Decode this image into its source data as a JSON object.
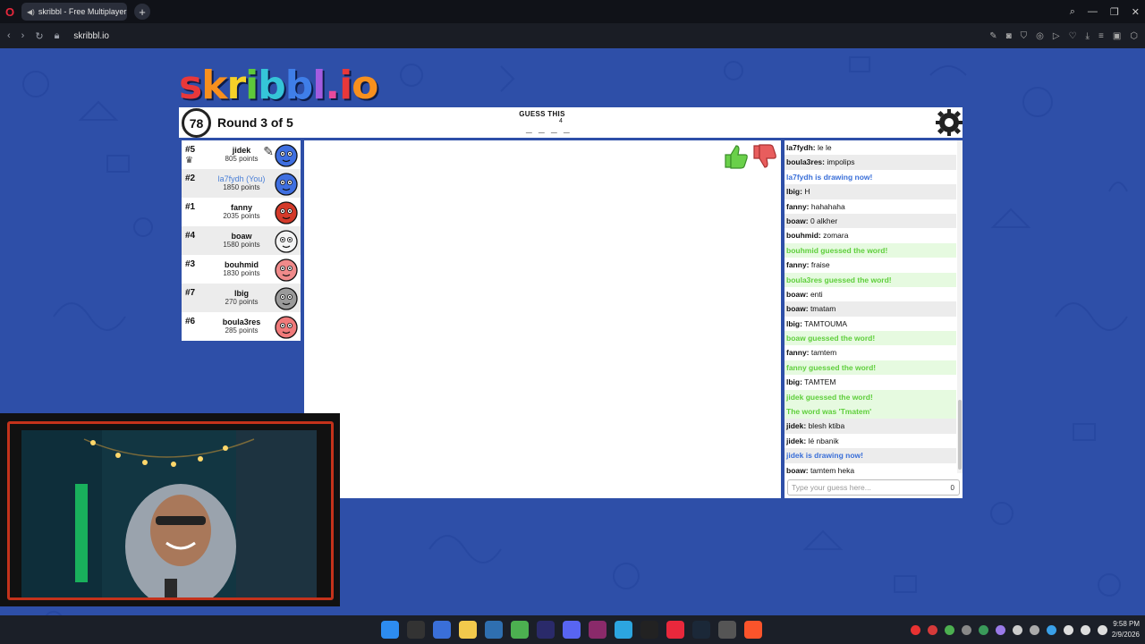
{
  "browser": {
    "tab_title": "skribbl - Free Multiplayer",
    "url": "skribbl.io",
    "new_tab_symbol": "+",
    "address_bar_icons": [
      "back-icon",
      "forward-icon",
      "reload-icon",
      "lock-icon"
    ],
    "window_controls": [
      "search-icon",
      "minimize-icon",
      "maximize-icon",
      "close-icon"
    ]
  },
  "game": {
    "logo_letters": [
      "s",
      "k",
      "r",
      "i",
      "b",
      "b",
      "l",
      ".",
      "i",
      "o"
    ],
    "logo_colors": [
      "#e8383a",
      "#f7901e",
      "#f6d128",
      "#5ec83a",
      "#35c5d8",
      "#3f7ee8",
      "#a35ce0",
      "#e84a9c",
      "#e8383a",
      "#f7901e"
    ],
    "timer": "78",
    "round_text": "Round 3 of 5",
    "guess_label": "GUESS THIS",
    "word_length": "4",
    "word_blanks": "_ _ _ _",
    "players": [
      {
        "rank": "#5",
        "name": "jidek",
        "points": "805 points",
        "you": false,
        "avatar_color": "#3f6fe0",
        "drawing": true
      },
      {
        "rank": "#2",
        "name": "la7fydh (You)",
        "points": "1850 points",
        "you": true,
        "avatar_color": "#3f6fe0",
        "drawing": false
      },
      {
        "rank": "#1",
        "name": "fanny",
        "points": "2035 points",
        "you": false,
        "avatar_color": "#d43a2a",
        "drawing": false
      },
      {
        "rank": "#4",
        "name": "boaw",
        "points": "1580 points",
        "you": false,
        "avatar_color": "#f4f4f4",
        "drawing": false
      },
      {
        "rank": "#3",
        "name": "bouhmid",
        "points": "1830 points",
        "you": false,
        "avatar_color": "#f08a8a",
        "drawing": false
      },
      {
        "rank": "#7",
        "name": "lbig",
        "points": "270 points",
        "you": false,
        "avatar_color": "#9a9a9a",
        "drawing": false
      },
      {
        "rank": "#6",
        "name": "boula3res",
        "points": "285 points",
        "you": false,
        "avatar_color": "#f07a7a",
        "drawing": false
      }
    ],
    "chat": [
      {
        "type": "msg",
        "user": "la7fydh:",
        "text": "le le"
      },
      {
        "type": "msg",
        "user": "boula3res:",
        "text": "impolips"
      },
      {
        "type": "blue",
        "text": "la7fydh is drawing now!"
      },
      {
        "type": "msg",
        "user": "lbig:",
        "text": "H"
      },
      {
        "type": "msg",
        "user": "fanny:",
        "text": "hahahaha"
      },
      {
        "type": "msg",
        "user": "boaw:",
        "text": "0 alkher"
      },
      {
        "type": "msg",
        "user": "bouhmid:",
        "text": "zomara"
      },
      {
        "type": "green",
        "text": "bouhmid guessed the word!"
      },
      {
        "type": "msg",
        "user": "fanny:",
        "text": "fraise"
      },
      {
        "type": "green",
        "text": "boula3res guessed the word!"
      },
      {
        "type": "msg",
        "user": "boaw:",
        "text": "enti"
      },
      {
        "type": "msg",
        "user": "boaw:",
        "text": "tmatam"
      },
      {
        "type": "msg",
        "user": "lbig:",
        "text": "TAMTOUMA"
      },
      {
        "type": "green",
        "text": "boaw guessed the word!"
      },
      {
        "type": "msg",
        "user": "fanny:",
        "text": "tamtem"
      },
      {
        "type": "green",
        "text": "fanny guessed the word!"
      },
      {
        "type": "msg",
        "user": "lbig:",
        "text": "TAMTEM"
      },
      {
        "type": "green",
        "text": "jidek guessed the word!"
      },
      {
        "type": "green",
        "text": "The word was 'Tmatem'"
      },
      {
        "type": "msg",
        "user": "jidek:",
        "text": "blesh ktiba"
      },
      {
        "type": "msg",
        "user": "jidek:",
        "text": "lé nbanik"
      },
      {
        "type": "blue",
        "text": "jidek is drawing now!"
      },
      {
        "type": "msg",
        "user": "boaw:",
        "text": "tamtem heka"
      }
    ],
    "chat_placeholder": "Type your guess here...",
    "chat_char_count": "0"
  },
  "taskbar": {
    "time": "9:58 PM",
    "date": "2/9/2026",
    "app_icons": [
      "windows-start-icon",
      "epic-games-icon",
      "vscode-icon",
      "file-explorer-icon",
      "lightroom-icon",
      "xbox-icon",
      "premiere-icon",
      "discord-icon",
      "vegas-icon",
      "telegram-icon",
      "obs-icon",
      "opera-gx-icon",
      "steam-icon",
      "steam-badge-icon",
      "brave-icon"
    ]
  }
}
